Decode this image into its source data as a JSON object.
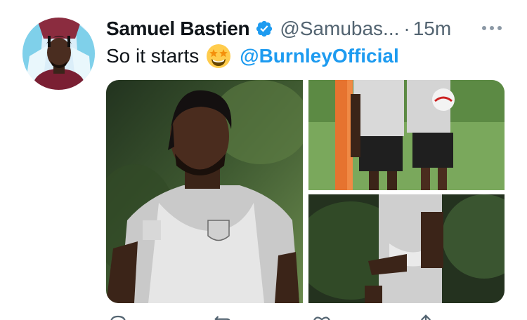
{
  "tweet": {
    "author_name": "Samuel Bastien",
    "handle": "@Samubas...",
    "separator": "·",
    "time": "15m",
    "text": "So it starts",
    "mention": "@BurnleyOfficial"
  },
  "icons": {
    "avatar": "avatar-photo",
    "verified": "verified-badge-icon",
    "emoji": "star-struck-emoji",
    "more": "more-options-icon",
    "reply": "reply-icon",
    "retweet": "retweet-icon",
    "like": "heart-icon",
    "share": "share-icon"
  },
  "colors": {
    "link": "#1d9bf0",
    "secondary_text": "#536471",
    "verified": "#1d9bf0"
  },
  "media": {
    "photo_count": 3
  }
}
